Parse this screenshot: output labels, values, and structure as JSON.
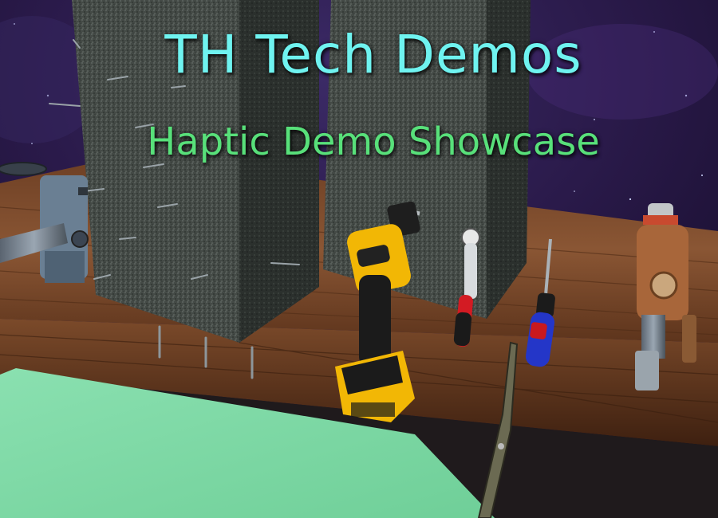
{
  "title": "TH Tech Demos",
  "subtitle": "Haptic Demo Showcase",
  "colors": {
    "title": "#6ff3f0",
    "subtitle": "#58e07a",
    "space": "#2a1a4a",
    "table_wood": "#7a4a2c",
    "concrete": "#3e4440",
    "floor_pad": "#7fd9a4"
  },
  "scene_objects": [
    "space-background",
    "wooden-workbench",
    "concrete-block-with-nails",
    "concrete-block-plain",
    "cordless-drill",
    "ratchet-handle",
    "screwdriver",
    "power-hammer-tool",
    "wrench-handle",
    "vise-clamp",
    "floor-mat"
  ]
}
